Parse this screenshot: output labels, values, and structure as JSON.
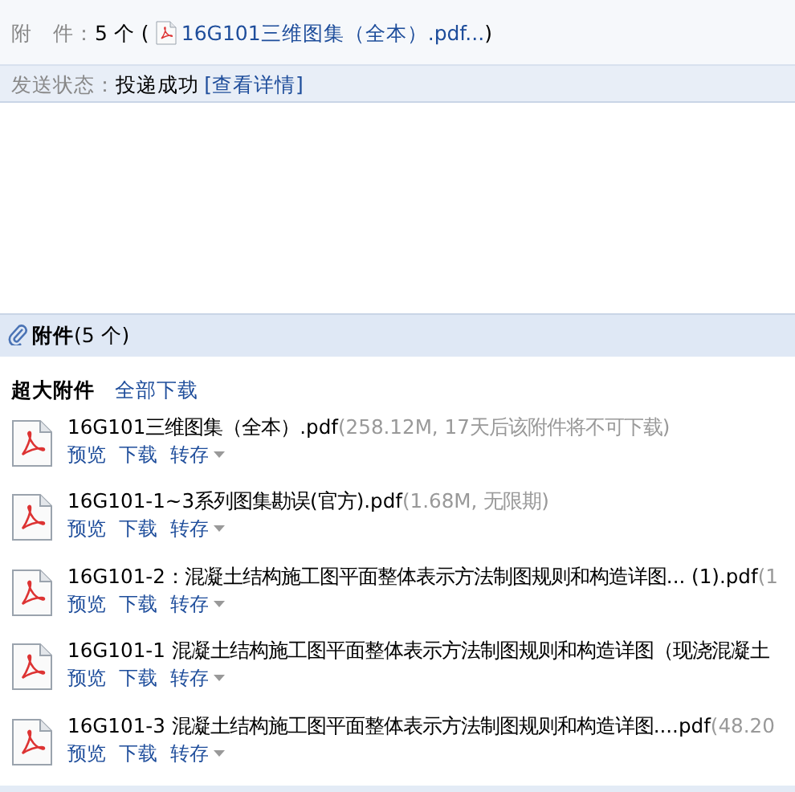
{
  "mail_info": {
    "attachment_label": "附　件：",
    "attachment_count": "5 个",
    "paren_open": "(",
    "attachment_link": "16G101三维图集（全本）.pdf...",
    "paren_close": ")"
  },
  "send_status": {
    "label": "发送状态：",
    "value": "投递成功",
    "details_link": "[查看详情]"
  },
  "attachments": {
    "title": "附件",
    "count": "(5 个)",
    "group_title": "超大附件",
    "download_all": "全部下载",
    "files": [
      {
        "name": "16G101三维图集（全本）.pdf",
        "meta": "(258.12M, 17天后该附件将不可下载)",
        "actions": [
          "预览",
          "下载",
          "转存"
        ]
      },
      {
        "name": "16G101-1~3系列图集勘误(官方).pdf",
        "meta": "(1.68M, 无限期)",
        "actions": [
          "预览",
          "下载",
          "转存"
        ]
      },
      {
        "name": "16G101-2：混凝土结构施工图平面整体表示方法制图规则和构造详图... (1).pdf",
        "meta": "(1",
        "actions": [
          "预览",
          "下载",
          "转存"
        ]
      },
      {
        "name": "16G101-1 混凝土结构施工图平面整体表示方法制图规则和构造详图（现浇混凝土",
        "actions": [
          "预览",
          "下载",
          "转存"
        ]
      },
      {
        "name": "16G101-3 混凝土结构施工图平面整体表示方法制图规则和构造详图....pdf",
        "meta": "(48.20",
        "actions": [
          "预览",
          "下载",
          "转存"
        ]
      }
    ]
  }
}
